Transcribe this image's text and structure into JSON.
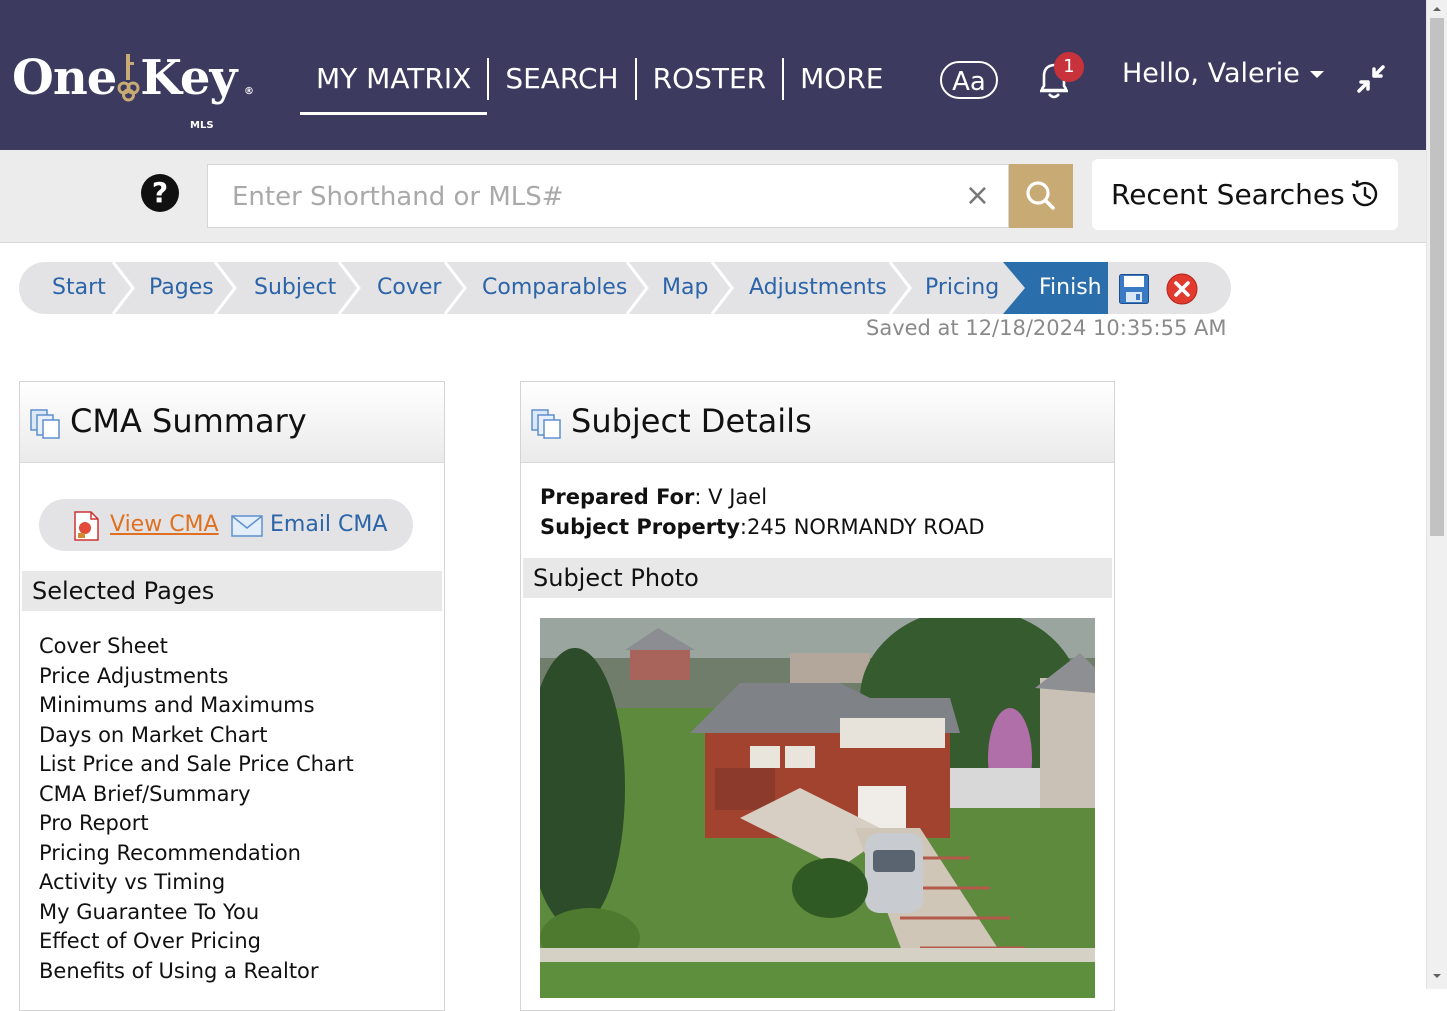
{
  "header": {
    "logo_text": "OneKey",
    "logo_sub": "MLS",
    "nav": [
      {
        "label": "MY MATRIX",
        "active": true
      },
      {
        "label": "SEARCH",
        "active": false
      },
      {
        "label": "ROSTER",
        "active": false
      },
      {
        "label": "MORE",
        "active": false
      }
    ],
    "font_size_button": "Aa",
    "notification_count": "1",
    "greeting": "Hello, Valerie",
    "bg_color": "#3c3a5e"
  },
  "search": {
    "placeholder": "Enter Shorthand or MLS#",
    "value": "",
    "help_label": "?",
    "clear_label": "×",
    "recent_label": "Recent Searches",
    "button_color": "#c8aa74"
  },
  "wizard": {
    "steps": [
      "Start",
      "Pages",
      "Subject",
      "Cover",
      "Comparables",
      "Map",
      "Adjustments",
      "Pricing",
      "Finish"
    ],
    "current": "Finish",
    "saved_text": "Saved at 12/18/2024 10:35:55 AM",
    "step_color": "#2b64a8",
    "current_color": "#2a6fab"
  },
  "summary": {
    "title": "CMA Summary",
    "view_label": "View CMA",
    "email_label": "Email CMA",
    "selected_heading": "Selected Pages",
    "pages": [
      "Cover Sheet",
      "Price Adjustments",
      "Minimums and Maximums",
      "Days on Market Chart",
      "List Price and Sale Price Chart",
      "CMA Brief/Summary",
      "Pro Report",
      "Pricing Recommendation",
      "Activity vs Timing",
      "My Guarantee To You",
      "Effect of Over Pricing",
      "Benefits of Using a Realtor"
    ]
  },
  "subject": {
    "title": "Subject Details",
    "prepared_label": "Prepared For",
    "prepared_value": ": V Jael",
    "property_label": "Subject Property",
    "property_value": ":245 NORMANDY ROAD",
    "photo_heading": "Subject Photo",
    "photo_icon": "house-photo"
  }
}
